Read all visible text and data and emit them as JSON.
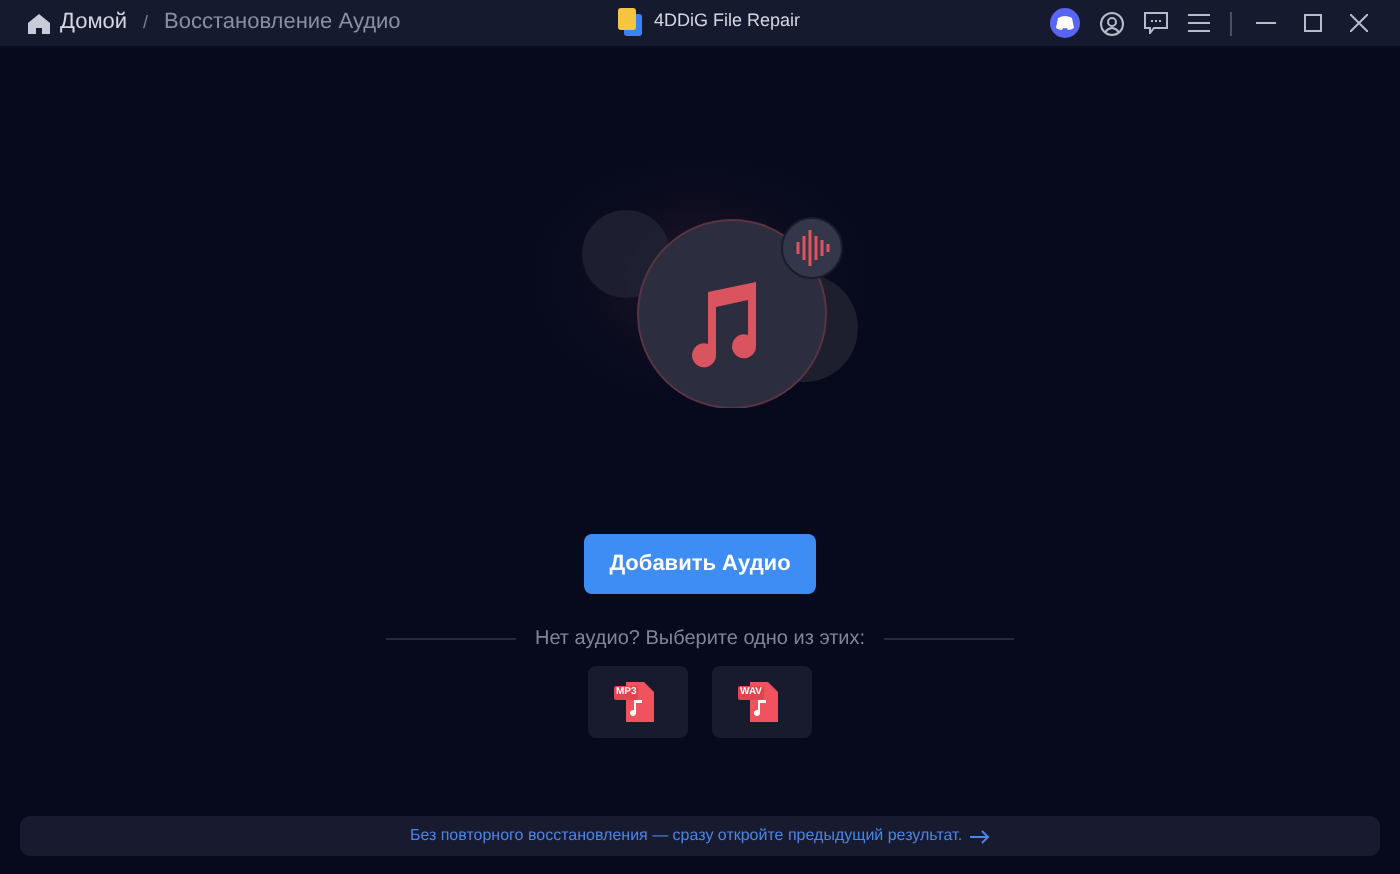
{
  "breadcrumb": {
    "home": "Домой",
    "separator": "/",
    "current": "Восстановление Аудио"
  },
  "window": {
    "title": "4DDiG File Repair"
  },
  "primary_button": "Добавить Аудио",
  "samples_heading": "Нет аудио? Выберите одно из этих:",
  "samples": [
    {
      "label": "MP3"
    },
    {
      "label": "WAV"
    }
  ],
  "footer_link": "Без повторного восстановления — сразу откройте предыдущий результат."
}
